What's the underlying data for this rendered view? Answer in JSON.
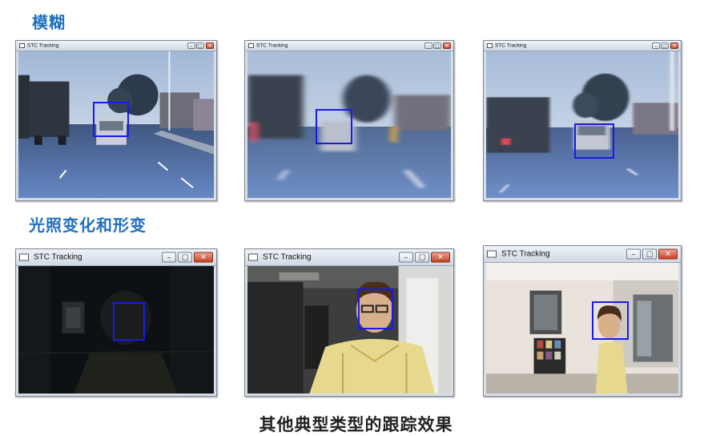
{
  "sections": {
    "blur_title": "模糊",
    "illum_title": "光照变化和形变"
  },
  "window_title": "STC Tracking",
  "window_buttons": {
    "minimize": "–",
    "maximize": "□",
    "close": "✕"
  },
  "caption": "其他典型类型的跟踪效果",
  "colors": {
    "accent": "#1f6fbf",
    "tracking_box": "#1a1ae6"
  }
}
